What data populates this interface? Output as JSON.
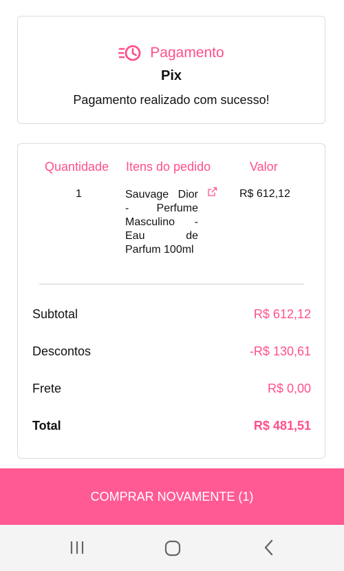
{
  "payment": {
    "title": "Pagamento",
    "method": "Pix",
    "status": "Pagamento realizado com sucesso!"
  },
  "order": {
    "headers": {
      "quantity": "Quantidade",
      "items": "Itens do pedido",
      "value": "Valor"
    },
    "rows": [
      {
        "quantity": "1",
        "item": "Sauvage Dior - Perfume Masculino - Eau de Parfum 100ml",
        "value": "R$ 612,12"
      }
    ]
  },
  "summary": {
    "subtotal_label": "Subtotal",
    "subtotal_value": "R$ 612,12",
    "discount_label": "Descontos",
    "discount_value": "-R$ 130,61",
    "shipping_label": "Frete",
    "shipping_value": "R$ 0,00",
    "total_label": "Total",
    "total_value": "R$ 481,51"
  },
  "actions": {
    "buy_again": "COMPRAR NOVAMENTE (1)"
  },
  "colors": {
    "accent": "#ff4f8c",
    "button": "#ff5a94",
    "border": "#dcdcdc"
  },
  "icons": {
    "payment": "clock-fast-icon",
    "external_link": "external-link-icon",
    "nav_recent": "recent-apps-icon",
    "nav_home": "home-icon",
    "nav_back": "back-icon"
  }
}
